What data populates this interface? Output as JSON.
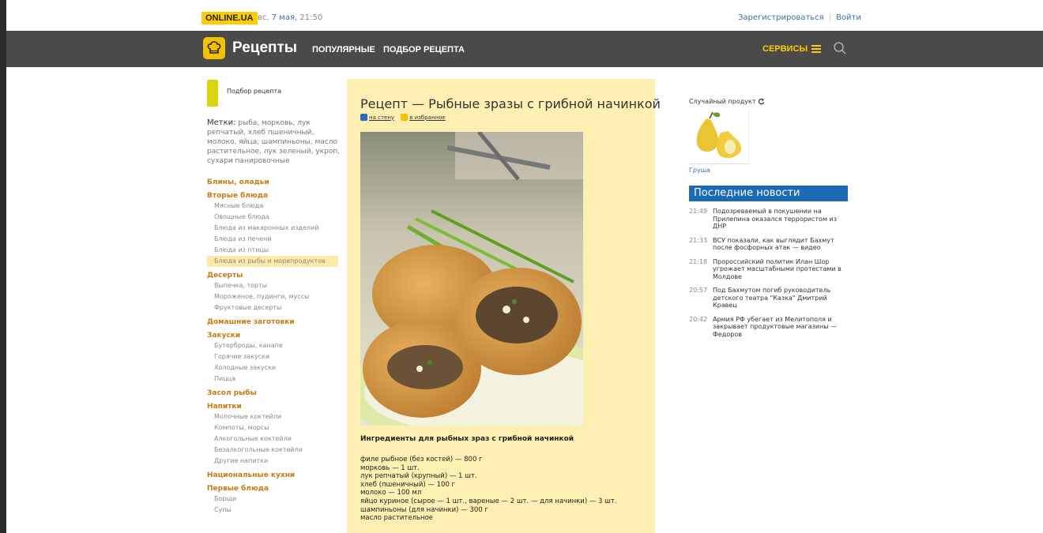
{
  "top": {
    "site": "ONLINE.UA",
    "date_prefix": "вс,",
    "date_link": "7 мая,",
    "time": "21:50",
    "register": "Зарегистрироваться",
    "login": "Войти"
  },
  "nav": {
    "brand": "Рецепты",
    "links": [
      "ПОПУЛЯРНЫЕ",
      "ПОДБОР РЕЦЕПТА"
    ],
    "services": "СЕРВИСЫ"
  },
  "sidebar": {
    "podbor": "Подбор рецепта",
    "tags_label": "Метки:",
    "tags": "рыба, морковь, лук репчатый, хлеб пшеничный, молоко, яйца, шампиньоны, масло растительное, лук зеленый, укроп, сухари панировочные",
    "categories": [
      {
        "name": "Блины, оладьи",
        "items": []
      },
      {
        "name": "Вторые блюда",
        "items": [
          "Мясные блюда",
          "Овощные блюда",
          "Блюда из макаронных изделий",
          "Блюда из печени",
          "Блюда из птицы",
          "Блюда из рыбы и морепродуктов"
        ]
      },
      {
        "name": "Десерты",
        "items": [
          "Выпечка, торты",
          "Мороженое, пудинги, муссы",
          "Фруктовые десерты"
        ]
      },
      {
        "name": "Домашние заготовки",
        "items": []
      },
      {
        "name": "Закуски",
        "items": [
          "Бутерброды, канапе",
          "Горячие закуски",
          "Холодные закуски",
          "Пицца"
        ]
      },
      {
        "name": "Засол рыбы",
        "items": []
      },
      {
        "name": "Напитки",
        "items": [
          "Молочные коктейли",
          "Компоты, морсы",
          "Алкогольные коктейли",
          "Безалкогольные коктейли",
          "Другие напитки"
        ]
      },
      {
        "name": "Национальные кухни",
        "items": []
      },
      {
        "name": "Первые блюда",
        "items": [
          "Борщи",
          "Супы"
        ]
      }
    ],
    "active_item": "Блюда из рыбы и морепродуктов"
  },
  "recipe": {
    "title": "Рецепт — Рыбные зразы с грибной начинкой",
    "share_wall": "на стену",
    "share_fav": "в избранное",
    "ingredients_title": "Ингредиенты для рыбных зраз с грибной начинкой",
    "ingredients": [
      "филе рыбное (без костей) — 800 г",
      "морковь — 1 шт.",
      "лук репчатый (крупный) — 1 шт.",
      "хлеб (пшеничный) — 100 г",
      "молоко — 100 мл",
      "яйцо куриное (сырое — 1 шт., вареные — 2 шт. — для начинки) — 3 шт.",
      "шампиньоны (для начинки) — 300 г",
      "масло растительное"
    ]
  },
  "right": {
    "random_label": "Случайный продукт",
    "product": "Груша",
    "news_title": "Последние новости",
    "news": [
      {
        "time": "21:49",
        "text": "Подозреваемый в покушении на Прилепина оказался террористом из ДНР"
      },
      {
        "time": "21:33",
        "text": "ВСУ показали, как выглядит Бахмут после фосфорных атак — видео"
      },
      {
        "time": "21:18",
        "text": "Пророссийский политик Илан Шор угрожает масштабными протестами в Молдове"
      },
      {
        "time": "20:57",
        "text": "Под Бахмутом погиб руководитель детского театра \"Казка\" Дмитрий Кравец"
      },
      {
        "time": "20:42",
        "text": "Армия РФ убегает из Мелитополя и закрывает продуктовые магазины — Федоров"
      }
    ]
  },
  "colors": {
    "accent": "#ffcc00",
    "nav": "#4a4a4a",
    "category": "#c77a10",
    "news_header": "#1a6ab5",
    "main_bg": "#fdefb1"
  }
}
